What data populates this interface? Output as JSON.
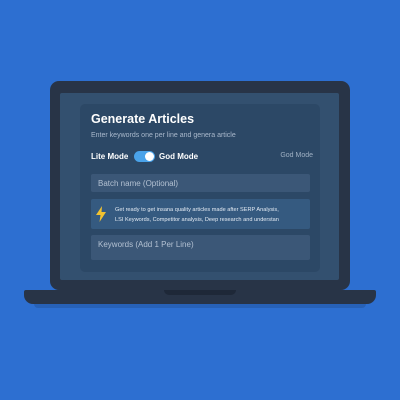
{
  "form": {
    "title": "Generate Articles",
    "subtitle": "Enter keywords one per line and genera article",
    "mode": {
      "lite_label": "Lite Mode",
      "god_label": "God Mode",
      "status": "God Mode",
      "toggle_on": true
    },
    "batch_name": {
      "placeholder": "Batch name (Optional)"
    },
    "info": {
      "icon": "lightning-icon",
      "line1": "Get ready to get insana quality articles made after SERP Analysis,",
      "line2": "LSI Keywords, Competitor analysis, Deep research and understan"
    },
    "keywords": {
      "placeholder": "Keywords (Add 1 Per Line)"
    }
  },
  "colors": {
    "background": "#2d6fd1",
    "laptop_frame": "#283447",
    "screen": "#33506f",
    "card": "#2c4866",
    "toggle_accent": "#4aa3ea",
    "bolt": "#f2c230"
  }
}
